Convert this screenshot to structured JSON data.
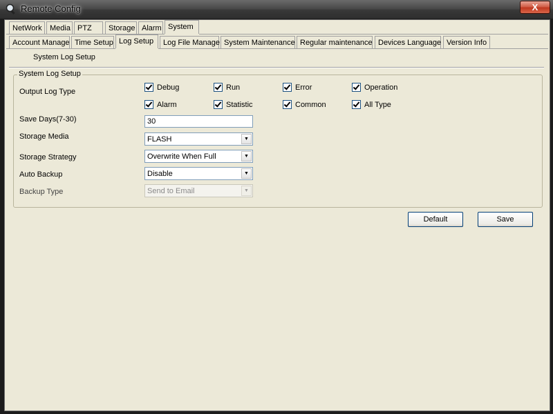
{
  "window": {
    "title": "Remote Config",
    "close_symbol": "X"
  },
  "main_tabs": [
    {
      "label": "NetWork"
    },
    {
      "label": "Media"
    },
    {
      "label": "PTZ"
    },
    {
      "label": "Storage"
    },
    {
      "label": "Alarm"
    },
    {
      "label": "System",
      "active": true
    }
  ],
  "sub_tabs": [
    {
      "label": "Account Manage"
    },
    {
      "label": "Time Setup"
    },
    {
      "label": "Log Setup",
      "active": true
    },
    {
      "label": "Log File Manage"
    },
    {
      "label": "System Maintenance"
    },
    {
      "label": "Regular maintenance"
    },
    {
      "label": "Devices Language"
    },
    {
      "label": "Version Info"
    }
  ],
  "section_title": "System Log Setup",
  "group": {
    "caption": "System Log Setup",
    "output_log_type_label": "Output Log Type",
    "log_types": [
      {
        "label": "Debug",
        "checked": true
      },
      {
        "label": "Run",
        "checked": true
      },
      {
        "label": "Error",
        "checked": true
      },
      {
        "label": "Operation",
        "checked": true
      },
      {
        "label": "Alarm",
        "checked": true
      },
      {
        "label": "Statistic",
        "checked": true
      },
      {
        "label": "Common",
        "checked": true
      },
      {
        "label": "All Type",
        "checked": true
      }
    ],
    "save_days": {
      "label": "Save Days(7-30)",
      "value": "30"
    },
    "storage_media": {
      "label": "Storage Media",
      "value": "FLASH"
    },
    "storage_strategy": {
      "label": "Storage Strategy",
      "value": "Overwrite When Full"
    },
    "auto_backup": {
      "label": "Auto Backup",
      "value": "Disable"
    },
    "backup_type": {
      "label": "Backup Type",
      "value": "Send to Email",
      "disabled": true
    }
  },
  "buttons": {
    "default_label": "Default",
    "save_label": "Save"
  },
  "colors": {
    "dialog_bg": "#ece9d8",
    "close_button": "#c0381f",
    "title_bar": "#3a3a3a"
  },
  "icons": {
    "app": "remote-config-icon",
    "close": "close-icon",
    "dropdown": "chevron-down-icon",
    "check": "check-icon"
  }
}
